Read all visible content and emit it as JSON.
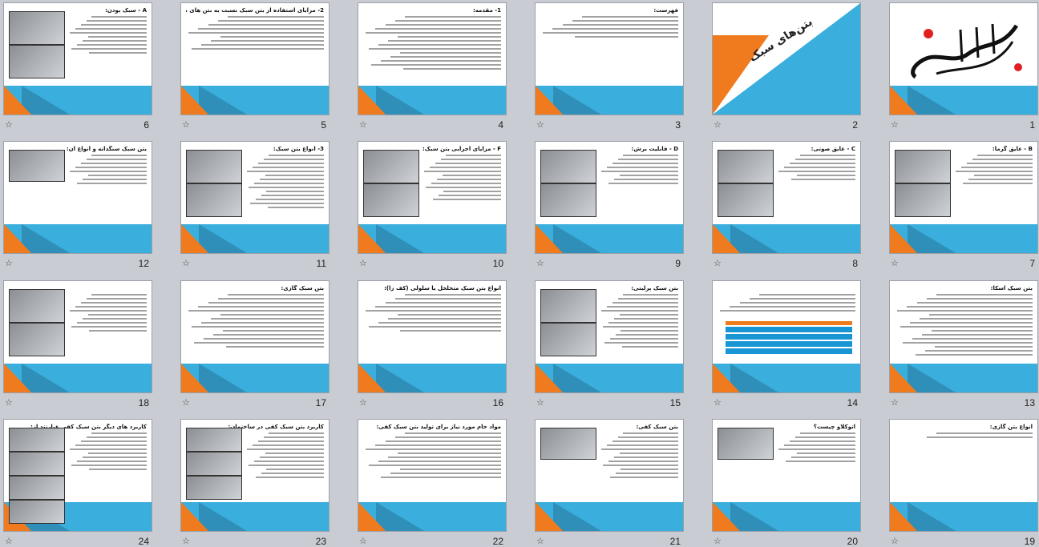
{
  "slides": [
    {
      "num": "1",
      "title": "",
      "type": "calligraphy",
      "images": 0
    },
    {
      "num": "2",
      "title": "بتن‌های سبک",
      "type": "cover",
      "images": 0
    },
    {
      "num": "3",
      "title": "فهرست:",
      "type": "text",
      "lines": 6,
      "images": 0
    },
    {
      "num": "4",
      "title": "1- مقدمه:",
      "type": "text",
      "lines": 14,
      "images": 0
    },
    {
      "num": "5",
      "title": "2- مزایای استفاده از بتن سبک نسبت به بتن های معمولی:",
      "type": "text",
      "lines": 9,
      "images": 0
    },
    {
      "num": "6",
      "title": "A - سبک بودن:",
      "type": "text-img",
      "lines": 10,
      "images": 2
    },
    {
      "num": "7",
      "title": "B - عایق گرما:",
      "type": "text-img",
      "lines": 8,
      "images": 2
    },
    {
      "num": "8",
      "title": "C - عایق صوتی:",
      "type": "text-img",
      "lines": 7,
      "images": 2
    },
    {
      "num": "9",
      "title": "D - قابلیت برش:",
      "type": "text-img",
      "lines": 8,
      "images": 2
    },
    {
      "num": "10",
      "title": "F - مزایای اجرایی بتن سبک:",
      "type": "text-img",
      "lines": 12,
      "images": 2
    },
    {
      "num": "11",
      "title": "3- انواع بتن سبک:",
      "type": "text-img",
      "lines": 14,
      "images": 2
    },
    {
      "num": "12",
      "title": "بتن سبک سنگدانه و انواع آن:",
      "type": "text-img",
      "lines": 8,
      "images": 1
    },
    {
      "num": "13",
      "title": "بتن سبک اسکا:",
      "type": "text",
      "lines": 16,
      "images": 0
    },
    {
      "num": "14",
      "title": "",
      "type": "table",
      "lines": 5,
      "images": 0
    },
    {
      "num": "15",
      "title": "بتن سبک پرلیتی:",
      "type": "text-img",
      "lines": 14,
      "images": 2
    },
    {
      "num": "16",
      "title": "انواع بتن سبک متخلخل یا سلولی (کف زا):",
      "type": "text",
      "lines": 10,
      "images": 0
    },
    {
      "num": "17",
      "title": "بتن سبک گازی:",
      "type": "text",
      "lines": 14,
      "images": 0
    },
    {
      "num": "18",
      "title": "",
      "type": "text-img",
      "lines": 10,
      "images": 2
    },
    {
      "num": "19",
      "title": "انواع بتن گازی:",
      "type": "text",
      "lines": 2,
      "images": 0
    },
    {
      "num": "20",
      "title": "اتوکلاو چیست؟",
      "type": "text-img",
      "lines": 8,
      "images": 1
    },
    {
      "num": "21",
      "title": "بتن سبک کفی:",
      "type": "text-img",
      "lines": 12,
      "images": 1
    },
    {
      "num": "22",
      "title": "مواد خام مورد نیاز برای تولید بتن سبک کفی:",
      "type": "text",
      "lines": 12,
      "images": 0
    },
    {
      "num": "23",
      "title": "کاربرد بتن سبک کفی در ساختمان:",
      "type": "text-img",
      "lines": 12,
      "images": 3
    },
    {
      "num": "24",
      "title": "کاربرد های دیگر بتن سبک کفی عبارتند از:",
      "type": "text-img",
      "lines": 10,
      "images": 4
    }
  ],
  "icons": {
    "star": "animation-star-icon"
  },
  "colors": {
    "accent_orange": "#f07a1e",
    "accent_blue": "#3aaedc",
    "bg": "#c9ccd2"
  }
}
